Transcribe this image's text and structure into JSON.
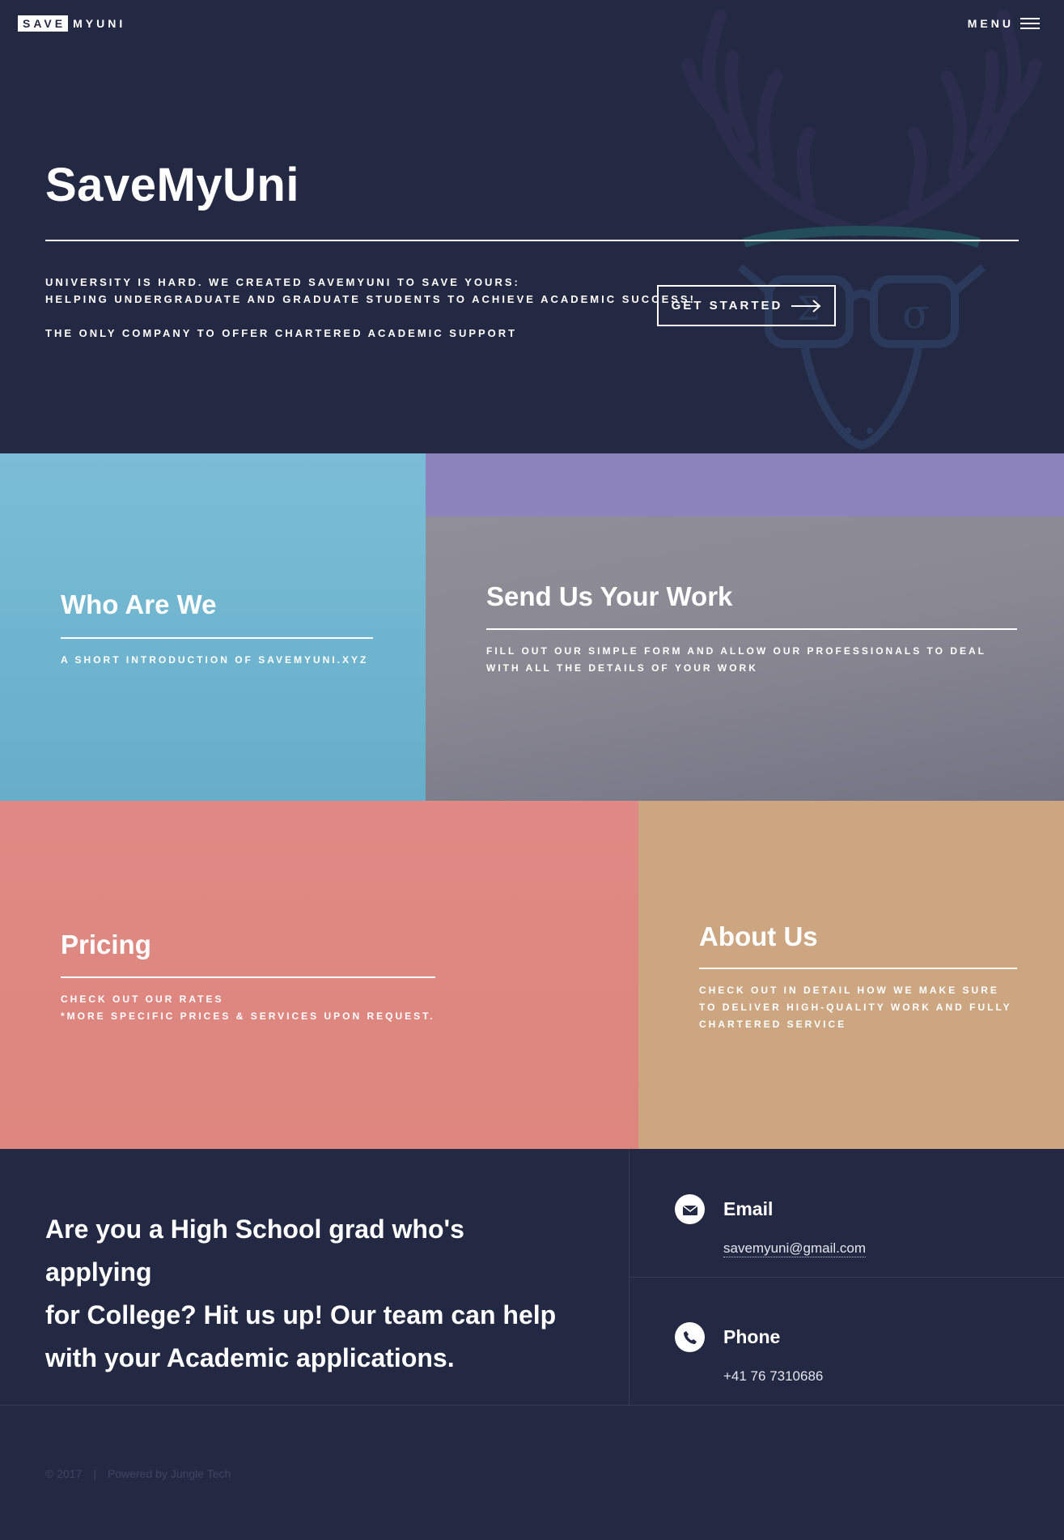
{
  "header": {
    "logo_save": "SAVE",
    "logo_rest": "MYUNI",
    "menu_label": "MENU"
  },
  "hero": {
    "title": "SaveMyUni",
    "line1": "UNIVERSITY IS HARD. WE CREATED SAVEMYUNI TO SAVE YOURS:",
    "line2": "HELPING UNDERGRADUATE AND GRADUATE STUDENTS TO ACHIEVE ACADEMIC SUCCESS!",
    "line3": "THE ONLY COMPANY TO OFFER CHARTERED ACADEMIC SUPPORT",
    "cta_label": "GET STARTED",
    "mascot_icon": "deer-with-glasses-icon"
  },
  "tiles": {
    "who": {
      "title": "Who Are We",
      "text": "A SHORT INTRODUCTION OF SAVEMYUNI.XYZ"
    },
    "send": {
      "title": "Send Us Your Work",
      "text_line1": "FILL OUT OUR SIMPLE FORM AND ALLOW OUR PROFESSIONALS TO DEAL",
      "text_line2": "WITH ALL THE DETAILS OF YOUR WORK"
    },
    "pricing": {
      "title": "Pricing",
      "text_line1": "CHECK OUT OUR RATES",
      "text_line2": "*MORE SPECIFIC PRICES & SERVICES UPON REQUEST."
    },
    "about": {
      "title": "About Us",
      "text_line1": "CHECK OUT IN DETAIL HOW WE MAKE SURE",
      "text_line2": "TO DELIVER HIGH-QUALITY WORK AND FULLY",
      "text_line3": "CHARTERED SERVICE"
    }
  },
  "contact": {
    "pitch_line1": "Are you a High School grad who's applying",
    "pitch_line2": "for College? Hit us up! Our team can help",
    "pitch_line3": "with your Academic applications.",
    "email_label": "Email",
    "email_value": "savemyuni@gmail.com",
    "email_icon": "envelope-icon",
    "phone_label": "Phone",
    "phone_value": "+41 76 7310686",
    "phone_icon": "phone-icon"
  },
  "footer": {
    "copyright": "© 2017",
    "separator": "|",
    "powered": "Powered by Jungle Tech"
  },
  "colors": {
    "background": "#242943",
    "who_tile": "#6fb4cf",
    "purple_band": "#8d84bd",
    "send_tile": "#858490",
    "pricing_tile": "#de877f",
    "about_tile": "#cca581"
  }
}
